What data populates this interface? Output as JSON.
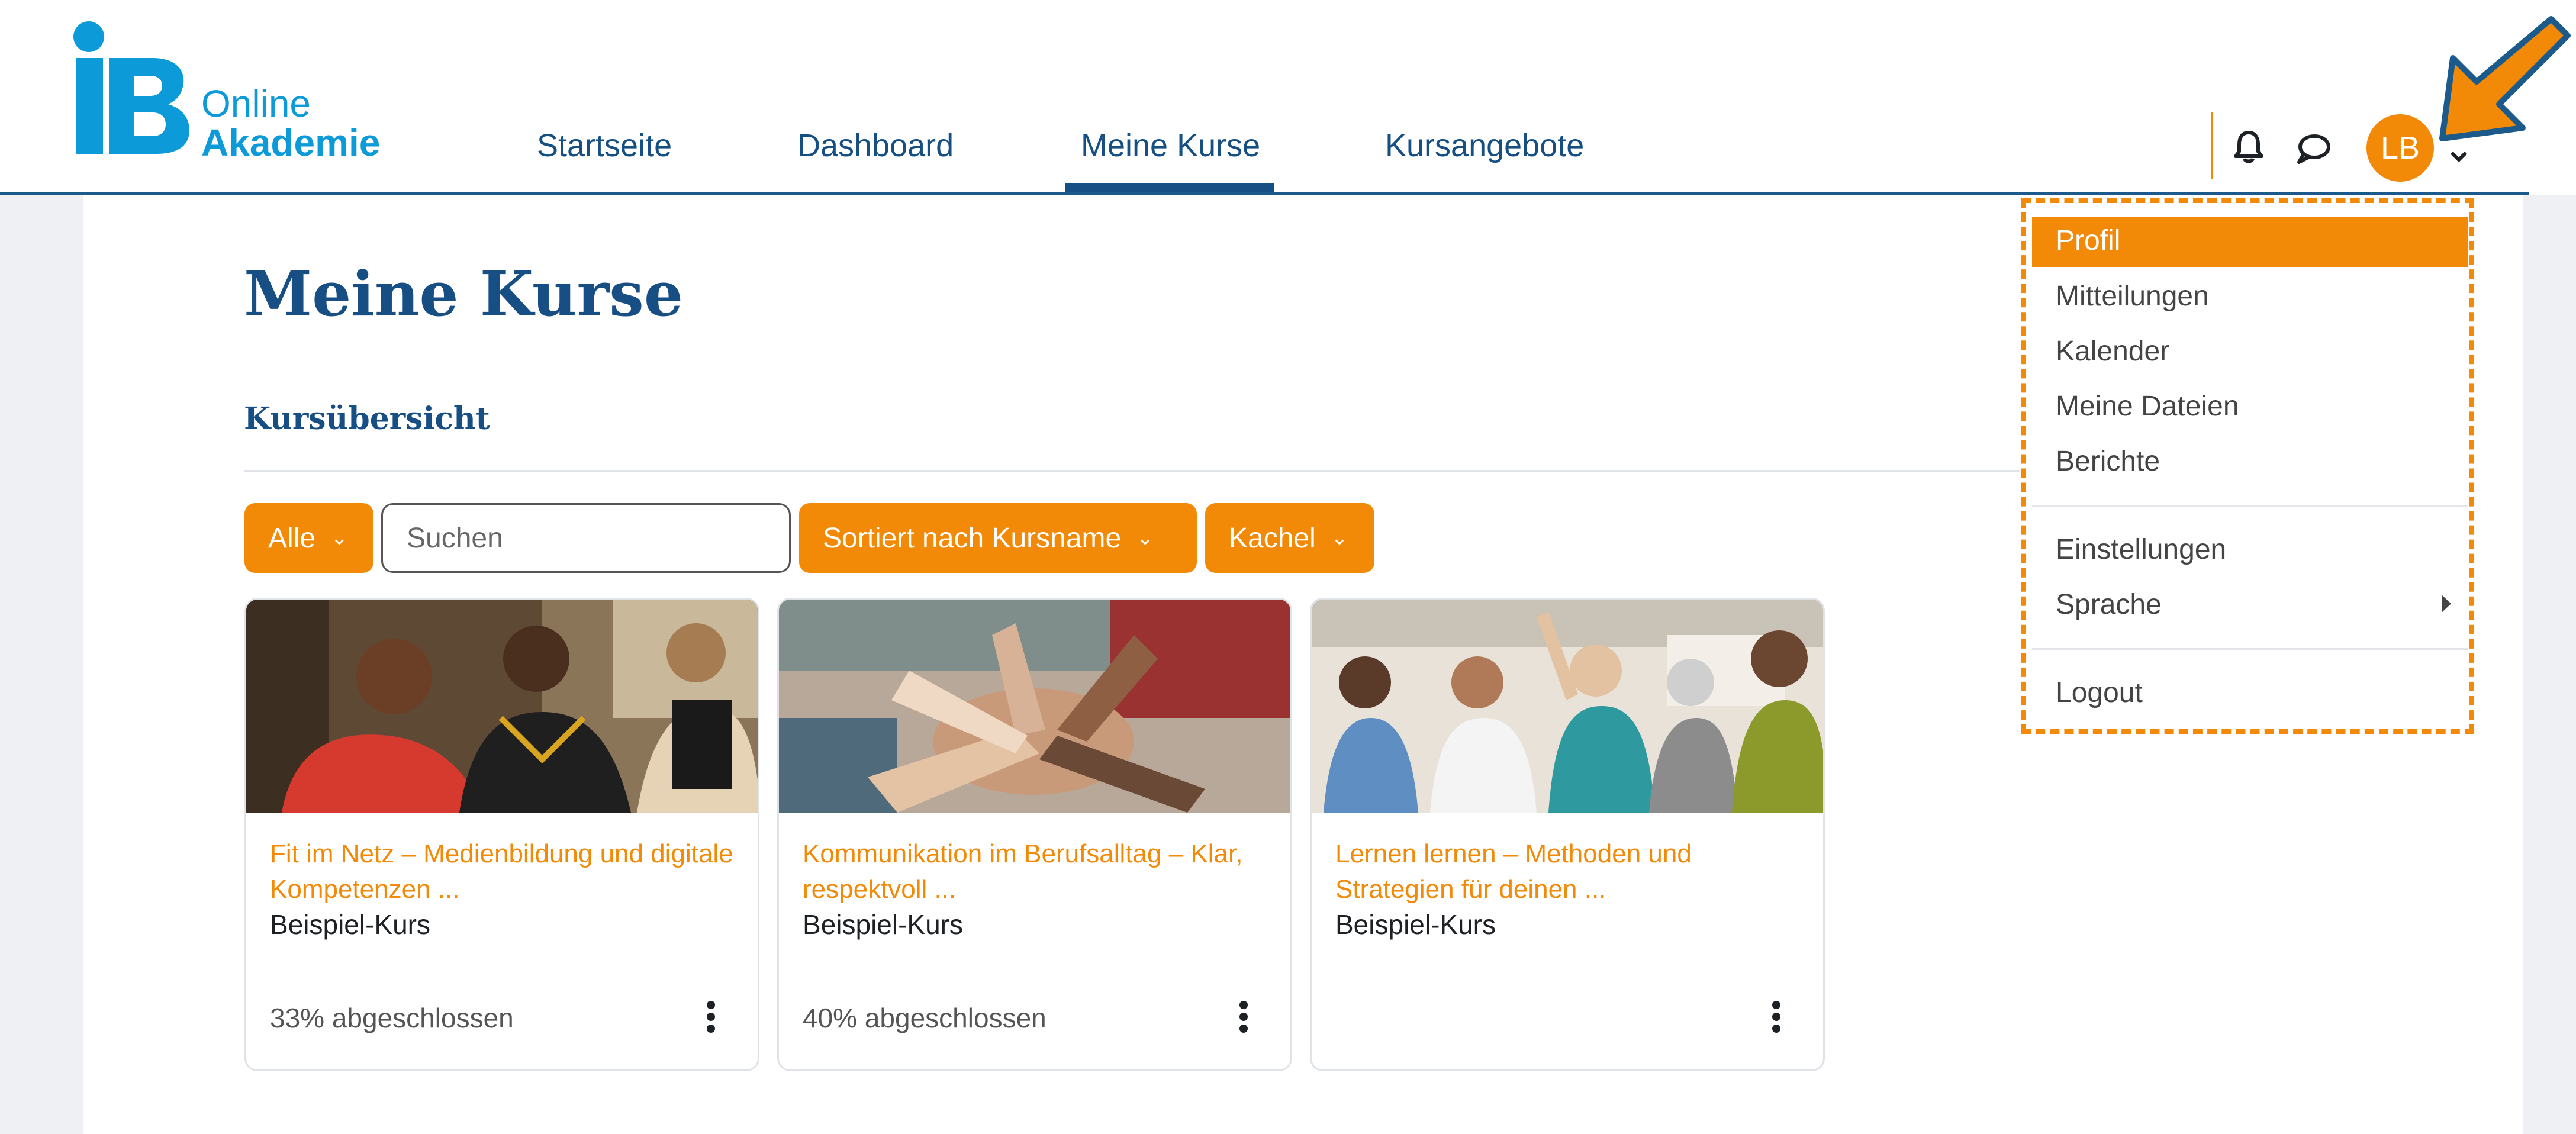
{
  "brand": {
    "logo_mark": "iB",
    "line1": "Online",
    "line2": "Akademie",
    "color": "#0d9ad8"
  },
  "nav": {
    "items": [
      {
        "label": "Startseite",
        "active": false
      },
      {
        "label": "Dashboard",
        "active": false
      },
      {
        "label": "Meine Kurse",
        "active": true
      },
      {
        "label": "Kursangebote",
        "active": false
      }
    ]
  },
  "header": {
    "icons": [
      "bell-icon",
      "chat-bubble-icon"
    ],
    "user_initials": "LB",
    "accent": "#f28a07",
    "nav_color": "#164f84"
  },
  "main": {
    "title": "Meine Kurse",
    "section": "Kursübersicht",
    "filters": {
      "status": "Alle",
      "search_placeholder": "Suchen",
      "sort": "Sortiert nach Kursname",
      "view": "Kachel"
    },
    "courses": [
      {
        "title": "Fit im Netz – Medienbildung und digitale Kompetenzen ...",
        "category": "Beispiel-Kurs",
        "progress": "33% abgeschlossen"
      },
      {
        "title": "Kommunikation im Berufsalltag – Klar, respektvoll ...",
        "category": "Beispiel-Kurs",
        "progress": "40% abgeschlossen"
      },
      {
        "title": "Lernen lernen – Methoden und Strategien für deinen ...",
        "category": "Beispiel-Kurs",
        "progress": ""
      }
    ]
  },
  "user_menu": {
    "items": [
      {
        "label": "Profil",
        "active": true
      },
      {
        "label": "Mitteilungen"
      },
      {
        "label": "Kalender"
      },
      {
        "label": "Meine Dateien"
      },
      {
        "label": "Berichte"
      },
      {
        "label": "Einstellungen"
      },
      {
        "label": "Sprache",
        "submenu": true
      },
      {
        "label": "Logout"
      }
    ]
  }
}
